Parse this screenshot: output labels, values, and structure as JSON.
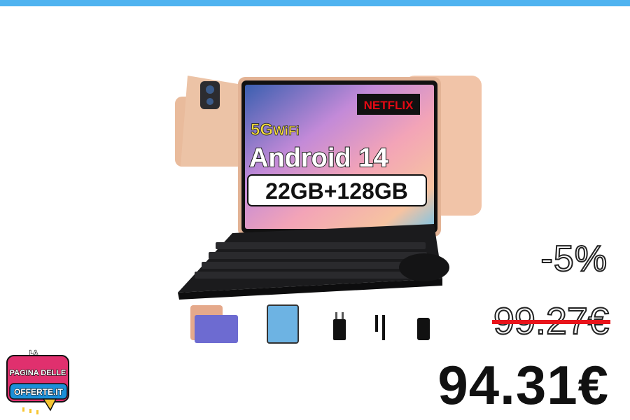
{
  "colors": {
    "top_bar": "#4fb3f0",
    "strike": "#e8141b",
    "tablet_frame": "#e7b08f",
    "keyboard": "#1b1b1d",
    "logo_pink": "#e0306e",
    "logo_blue": "#1b8fd8",
    "logo_yellow": "#f7c531"
  },
  "product": {
    "screen_badges": {
      "wifi": "5G",
      "wifi_suffix": "WiFi",
      "brand": "NETFLIX",
      "os": "Android 14",
      "storage": "22GB+128GB"
    },
    "accessories": [
      "case-icon",
      "screen-protector-icon",
      "charger-icon",
      "usb-cable-icon",
      "otg-adapter-icon"
    ]
  },
  "pricing": {
    "discount": "-5%",
    "old_price": "99.27€",
    "new_price": "94.31€"
  },
  "logo": {
    "line1": "LA",
    "line2": "PAGINA DELLE",
    "line3": "OFFERTE.IT"
  }
}
